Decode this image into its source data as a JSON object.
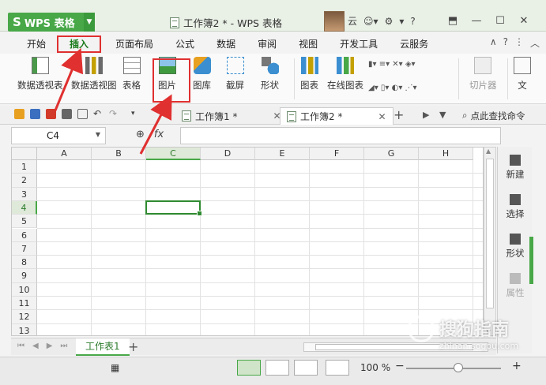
{
  "titlebar": {
    "app_name": "WPS 表格",
    "doc_title": "工作簿2 * - WPS 表格",
    "cloud": "云",
    "skin": "?"
  },
  "menu": {
    "items": [
      "开始",
      "插入",
      "页面布局",
      "公式",
      "数据",
      "审阅",
      "视图",
      "开发工具",
      "云服务"
    ],
    "active_index": 1
  },
  "ribbon": {
    "pivot_table": "数据透视表",
    "pivot_chart": "数据透视图",
    "table": "表格",
    "picture": "图片",
    "gallery": "图库",
    "screenshot": "截屏",
    "shapes": "形状",
    "chart": "图表",
    "online_chart": "在线图表",
    "slicer": "切片器",
    "text": "文"
  },
  "doc_tabs": [
    {
      "label": "工作簿1 *",
      "active": false
    },
    {
      "label": "工作簿2 *",
      "active": true
    }
  ],
  "find_command": "点此查找命令",
  "formula_bar": {
    "cell_ref": "C4",
    "fx": "fx",
    "value": ""
  },
  "grid": {
    "columns": [
      "A",
      "B",
      "C",
      "D",
      "E",
      "F",
      "G",
      "H"
    ],
    "rows": [
      "1",
      "2",
      "3",
      "4",
      "5",
      "6",
      "7",
      "8",
      "9",
      "10",
      "11",
      "12",
      "13"
    ],
    "active_col": "C",
    "active_row": "4"
  },
  "task_pane": [
    {
      "label": "新建"
    },
    {
      "label": "选择"
    },
    {
      "label": "形状"
    },
    {
      "label": "属性"
    }
  ],
  "sheets": {
    "tabs": [
      "工作表1"
    ],
    "active": "工作表1"
  },
  "status": {
    "zoom": "100 %"
  },
  "watermark": {
    "brand": "搜狗指南",
    "url": "zhinan.sogou.com"
  }
}
